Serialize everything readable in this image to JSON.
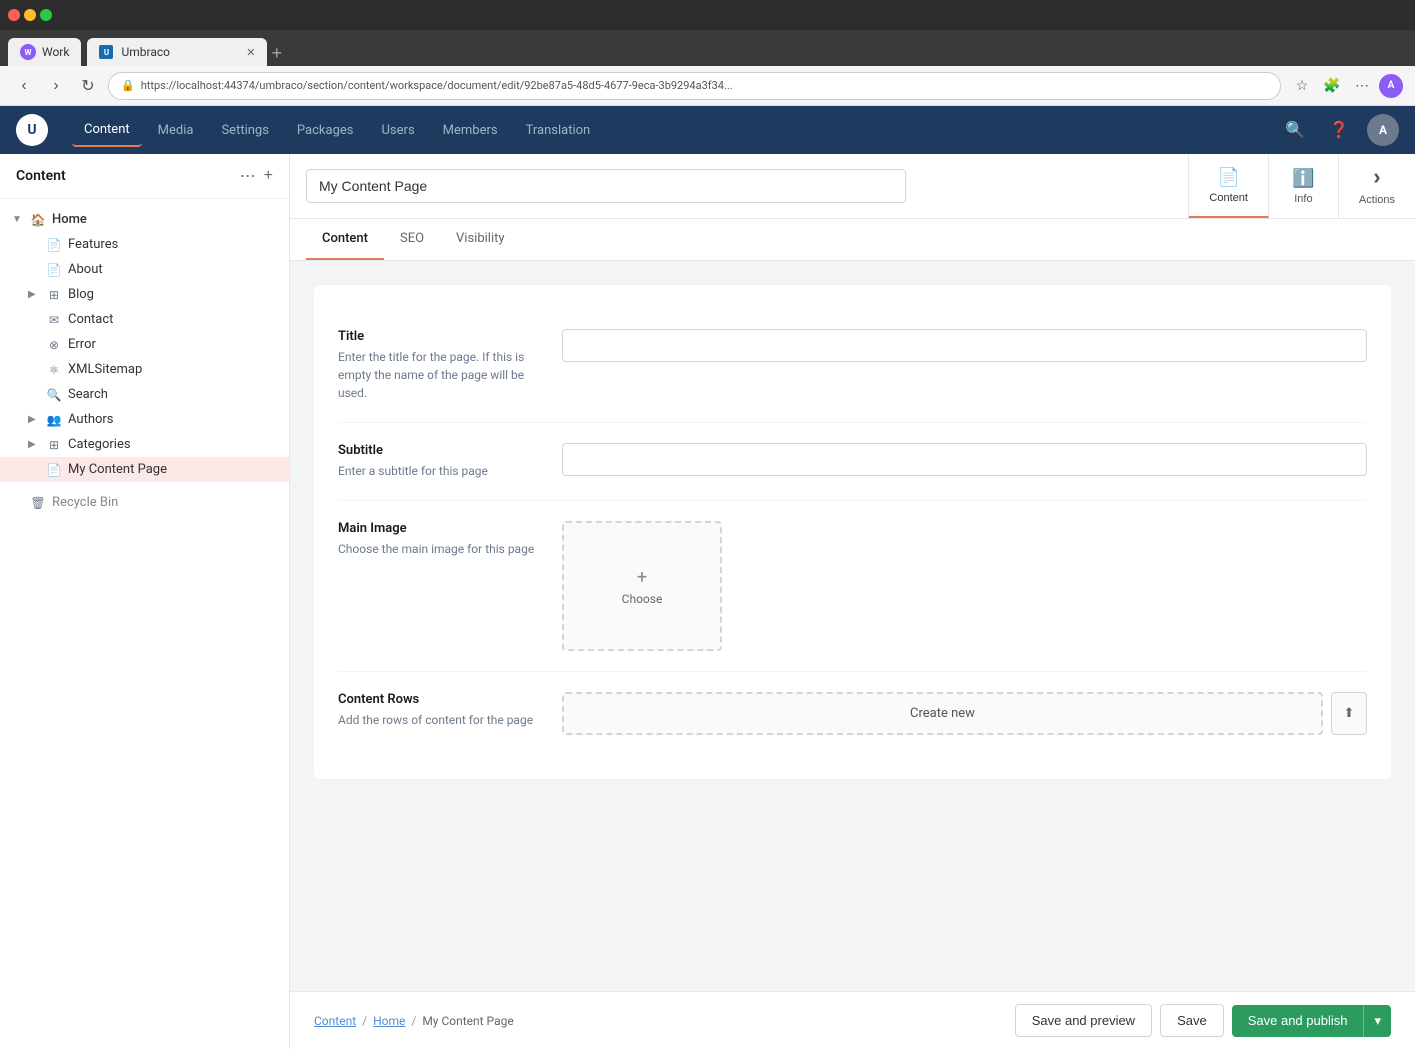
{
  "browser": {
    "url": "https://localhost:44374/umbraco/section/content/workspace/document/edit/92be87a5-48d5-4677-9eca-3b9294a3f34...",
    "tab_title": "Umbraco",
    "work_tab_label": "Work"
  },
  "top_nav": {
    "logo_text": "U",
    "items": [
      {
        "id": "content",
        "label": "Content",
        "active": true
      },
      {
        "id": "media",
        "label": "Media",
        "active": false
      },
      {
        "id": "settings",
        "label": "Settings",
        "active": false
      },
      {
        "id": "packages",
        "label": "Packages",
        "active": false
      },
      {
        "id": "users",
        "label": "Users",
        "active": false
      },
      {
        "id": "members",
        "label": "Members",
        "active": false
      },
      {
        "id": "translation",
        "label": "Translation",
        "active": false
      }
    ],
    "user_initials": "A"
  },
  "sidebar": {
    "title": "Content",
    "tree": [
      {
        "id": "home",
        "label": "Home",
        "level": 0,
        "expanded": true,
        "icon": "house",
        "has_children": true
      },
      {
        "id": "features",
        "label": "Features",
        "level": 1,
        "icon": "doc",
        "has_children": false
      },
      {
        "id": "about",
        "label": "About",
        "level": 1,
        "icon": "doc",
        "has_children": false
      },
      {
        "id": "blog",
        "label": "Blog",
        "level": 1,
        "icon": "grid",
        "has_children": true,
        "expanded": false
      },
      {
        "id": "contact",
        "label": "Contact",
        "level": 1,
        "icon": "envelope",
        "has_children": false
      },
      {
        "id": "error",
        "label": "Error",
        "level": 1,
        "icon": "circle-x",
        "has_children": false
      },
      {
        "id": "xmlsitemap",
        "label": "XMLSitemap",
        "level": 1,
        "icon": "network",
        "has_children": false
      },
      {
        "id": "search",
        "label": "Search",
        "level": 1,
        "icon": "magnifier",
        "has_children": false
      },
      {
        "id": "authors",
        "label": "Authors",
        "level": 1,
        "icon": "people",
        "has_children": true,
        "expanded": false
      },
      {
        "id": "categories",
        "label": "Categories",
        "level": 1,
        "icon": "tag-grid",
        "has_children": true,
        "expanded": false
      },
      {
        "id": "my-content-page",
        "label": "My Content Page",
        "level": 1,
        "icon": "doc",
        "has_children": false,
        "active": true
      },
      {
        "id": "recycle-bin",
        "label": "Recycle Bin",
        "level": 0,
        "icon": "trash",
        "has_children": false
      }
    ]
  },
  "document": {
    "name": "My Content Page",
    "header_buttons": [
      {
        "id": "content-btn",
        "label": "Content",
        "icon": "📄",
        "active": true
      },
      {
        "id": "info-btn",
        "label": "Info",
        "icon": "ℹ️",
        "active": false
      },
      {
        "id": "actions-btn",
        "label": "Actions",
        "icon": "›",
        "active": false
      }
    ],
    "tabs": [
      {
        "id": "content",
        "label": "Content",
        "active": true
      },
      {
        "id": "seo",
        "label": "SEO",
        "active": false
      },
      {
        "id": "visibility",
        "label": "Visibility",
        "active": false
      }
    ],
    "fields": [
      {
        "id": "title",
        "label": "Title",
        "description": "Enter the title for the page. If this is empty the name of the page will be used.",
        "type": "text",
        "value": "",
        "placeholder": ""
      },
      {
        "id": "subtitle",
        "label": "Subtitle",
        "description": "Enter a subtitle for this page",
        "type": "text",
        "value": "",
        "placeholder": ""
      },
      {
        "id": "main-image",
        "label": "Main Image",
        "description": "Choose the main image for this page",
        "type": "image",
        "button_label": "+ Choose"
      },
      {
        "id": "content-rows",
        "label": "Content Rows",
        "description": "Add the rows of content for the page",
        "type": "content-rows",
        "create_new_label": "Create new"
      }
    ]
  },
  "footer": {
    "breadcrumb": [
      {
        "id": "content",
        "label": "Content",
        "link": true
      },
      {
        "id": "home",
        "label": "Home",
        "link": true
      },
      {
        "id": "page",
        "label": "My Content Page",
        "link": false
      }
    ],
    "save_preview_label": "Save and preview",
    "save_label": "Save",
    "publish_label": "Save and publish"
  }
}
